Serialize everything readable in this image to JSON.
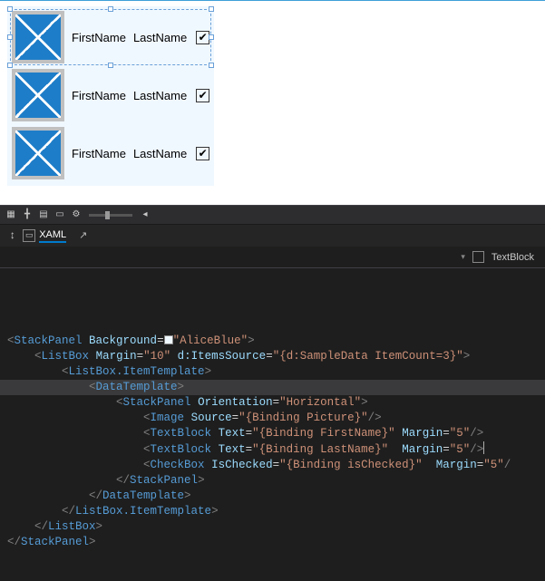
{
  "designer": {
    "items": [
      {
        "first": "FirstName",
        "last": "LastName",
        "checked": true,
        "selected": true
      },
      {
        "first": "FirstName",
        "last": "LastName",
        "checked": true,
        "selected": false
      },
      {
        "first": "FirstName",
        "last": "LastName",
        "checked": true,
        "selected": false
      }
    ]
  },
  "tabs": {
    "xaml": "XAML"
  },
  "breadcrumb": {
    "current": "TextBlock"
  },
  "code": {
    "l1": {
      "e": "StackPanel",
      "a1": "Background",
      "v1": "AliceBlue"
    },
    "l2": {
      "e": "ListBox",
      "a1": "Margin",
      "v1": "10",
      "a2": "d:ItemsSource",
      "v2": "{d:SampleData ItemCount=3}"
    },
    "l3": {
      "e": "ListBox.ItemTemplate"
    },
    "l4": {
      "e": "DataTemplate"
    },
    "l5": {
      "e": "StackPanel",
      "a1": "Orientation",
      "v1": "Horizontal"
    },
    "l6": {
      "e": "Image",
      "a1": "Source",
      "v1": "{Binding Picture}"
    },
    "l7": {
      "e": "TextBlock",
      "a1": "Text",
      "v1": "{Binding FirstName}",
      "a2": "Margin",
      "v2": "5"
    },
    "l8": {
      "e": "TextBlock",
      "a1": "Text",
      "v1": "{Binding LastName}",
      "a2": "Margin",
      "v2": "5"
    },
    "l9": {
      "e": "CheckBox",
      "a1": "IsChecked",
      "v1": "{Binding isChecked}",
      "a2": "Margin",
      "v2": "5"
    },
    "l10": {
      "e": "StackPanel"
    },
    "l11": {
      "e": "DataTemplate"
    },
    "l12": {
      "e": "ListBox.ItemTemplate"
    },
    "l13": {
      "e": "ListBox"
    },
    "l14": {
      "e": "StackPanel"
    }
  }
}
